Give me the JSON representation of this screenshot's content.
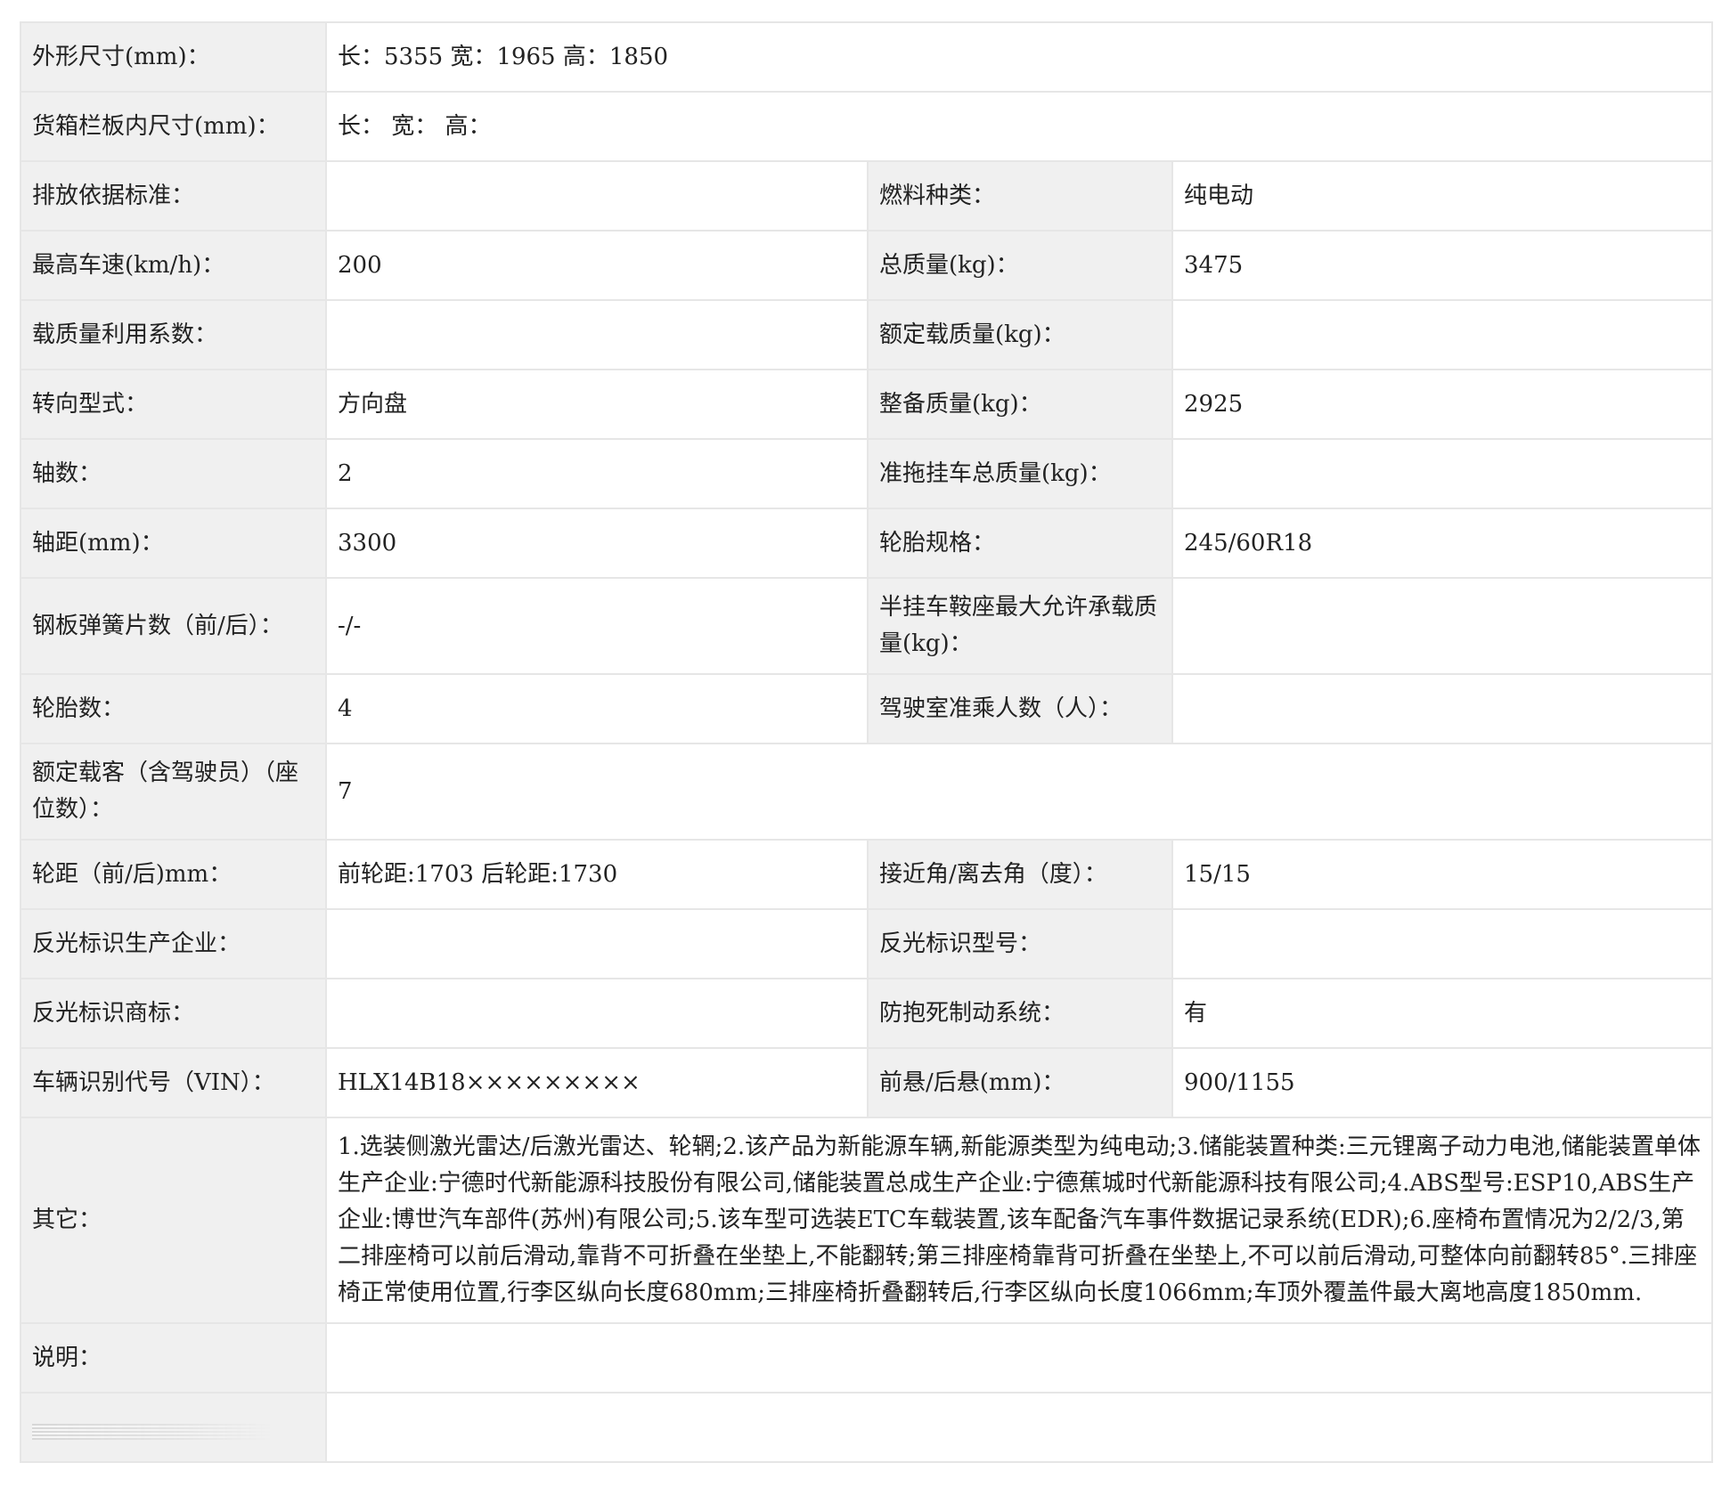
{
  "rows": [
    {
      "label": "外形尺寸(mm)：",
      "value": "长：5355 宽：1965 高：1850"
    },
    {
      "label": "货箱栏板内尺寸(mm)：",
      "value": "长： 宽： 高："
    },
    {
      "label": "排放依据标准：",
      "value": "",
      "label2": "燃料种类：",
      "value2": "纯电动"
    },
    {
      "label": "最高车速(km/h)：",
      "value": "200",
      "label2": "总质量(kg)：",
      "value2": "3475"
    },
    {
      "label": "载质量利用系数：",
      "value": "",
      "label2": "额定载质量(kg)：",
      "value2": ""
    },
    {
      "label": "转向型式：",
      "value": "方向盘",
      "label2": "整备质量(kg)：",
      "value2": "2925"
    },
    {
      "label": "轴数：",
      "value": "2",
      "label2": "准拖挂车总质量(kg)：",
      "value2": ""
    },
    {
      "label": "轴距(mm)：",
      "value": "3300",
      "label2": "轮胎规格：",
      "value2": "245/60R18"
    },
    {
      "label": "钢板弹簧片数（前/后）：",
      "value": "-/-",
      "label2": "半挂车鞍座最大允许承载质量(kg)：",
      "value2": ""
    },
    {
      "label": "轮胎数：",
      "value": "4",
      "label2": "驾驶室准乘人数（人）：",
      "value2": ""
    },
    {
      "label": "额定载客（含驾驶员）（座位数）：",
      "value": "7"
    },
    {
      "label": "轮距（前/后)mm：",
      "value": "前轮距:1703 后轮距:1730",
      "label2": "接近角/离去角（度）：",
      "value2": "15/15"
    },
    {
      "label": "反光标识生产企业：",
      "value": "",
      "label2": "反光标识型号：",
      "value2": ""
    },
    {
      "label": "反光标识商标：",
      "value": "",
      "label2": "防抱死制动系统：",
      "value2": "有"
    },
    {
      "label": "车辆识别代号（VIN）：",
      "value": "HLX14B18×××××××××",
      "label2": "前悬/后悬(mm)：",
      "value2": "900/1155"
    },
    {
      "label": "其它：",
      "value": "1.选装侧激光雷达/后激光雷达、轮辋;2.该产品为新能源车辆,新能源类型为纯电动;3.储能装置种类:三元锂离子动力电池,储能装置单体生产企业:宁德时代新能源科技股份有限公司,储能装置总成生产企业:宁德蕉城时代新能源科技有限公司;4.ABS型号:ESP10,ABS生产企业:博世汽车部件(苏州)有限公司;5.该车型可选装ETC车载装置,该车配备汽车事件数据记录系统(EDR);6.座椅布置情况为2/2/3,第二排座椅可以前后滑动,靠背不可折叠在坐垫上,不能翻转;第三排座椅靠背可折叠在坐垫上,不可以前后滑动,可整体向前翻转85°.三排座椅正常使用位置,行李区纵向长度680mm;三排座椅折叠翻转后,行李区纵向长度1066mm;车顶外覆盖件最大离地高度1850mm."
    },
    {
      "label": "说明：",
      "value": ""
    }
  ]
}
